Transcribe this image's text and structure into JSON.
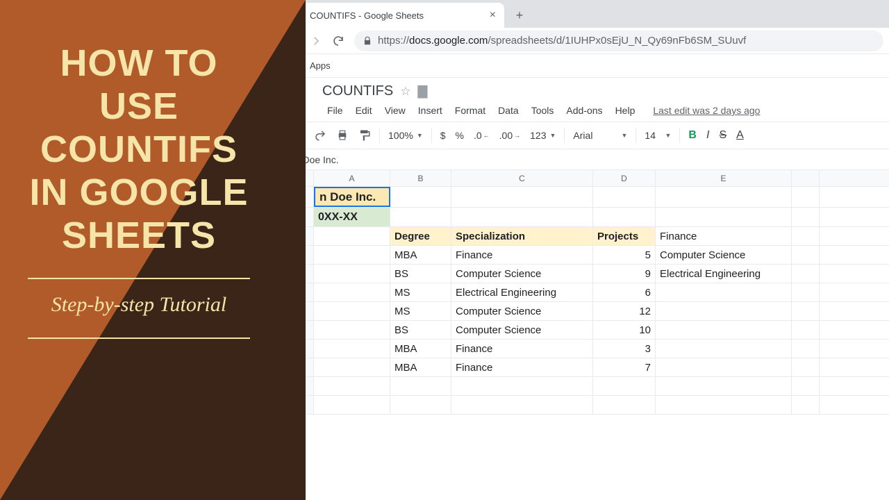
{
  "banner": {
    "title_lines": [
      "HOW TO",
      "USE",
      "COUNTIFS",
      "IN GOOGLE",
      "SHEETS"
    ],
    "subtitle": "Step-by-step Tutorial"
  },
  "browser": {
    "tab_title": "COUNTIFS - Google Sheets",
    "url_prefix": "https://",
    "url_host": "docs.google.com",
    "url_path": "/spreadsheets/d/1IUHPx0sEjU_N_Qy69nFb6SM_SUuvf",
    "bookmarks_label": "Apps"
  },
  "sheets": {
    "doc_title": "COUNTIFS",
    "menus": [
      "File",
      "Edit",
      "View",
      "Insert",
      "Format",
      "Data",
      "Tools",
      "Add-ons",
      "Help"
    ],
    "last_edit": "Last edit was 2 days ago",
    "toolbar": {
      "zoom": "100%",
      "currency": "$",
      "percent": "%",
      "dec_dec": ".0",
      "inc_dec": ".00",
      "num_fmt": "123",
      "font": "Arial",
      "size": "14",
      "bold": "B",
      "italic": "I",
      "strike": "S",
      "textcolor": "A"
    },
    "formula_bar_value": "hn Doe Inc."
  },
  "grid": {
    "columns": [
      "A",
      "B",
      "C",
      "D",
      "E"
    ],
    "row1_A": "n Doe Inc.",
    "row2_A": "0XX-XX",
    "headers": {
      "B": "Degree",
      "C": "Specialization",
      "D": "Projects",
      "E": "Finance"
    },
    "data": [
      {
        "B": "MBA",
        "C": "Finance",
        "D": "5",
        "E": "Computer Science"
      },
      {
        "B": "BS",
        "C": "Computer Science",
        "D": "9",
        "E": "Electrical Engineering"
      },
      {
        "B": "MS",
        "C": "Electrical Engineering",
        "D": "6",
        "E": ""
      },
      {
        "B": "MS",
        "C": "Computer Science",
        "D": "12",
        "E": ""
      },
      {
        "B": "BS",
        "C": "Computer Science",
        "D": "10",
        "E": ""
      },
      {
        "B": "MBA",
        "C": "Finance",
        "D": "3",
        "E": ""
      },
      {
        "B": "MBA",
        "C": "Finance",
        "D": "7",
        "E": ""
      }
    ]
  }
}
